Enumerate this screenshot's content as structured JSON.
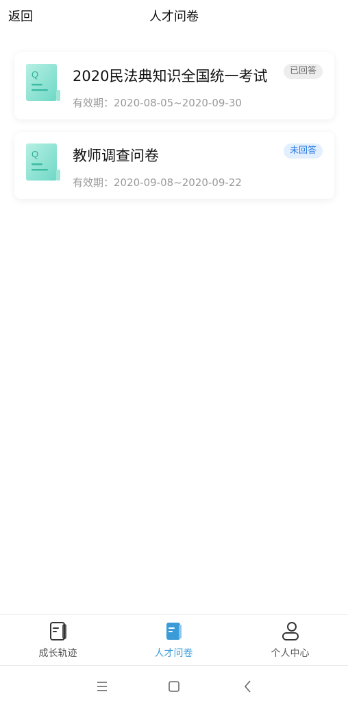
{
  "header": {
    "back_label": "返回",
    "title": "人才问卷"
  },
  "surveys": [
    {
      "title": "2020民法典知识全国统一考试",
      "validity": "有效期：2020-08-05~2020-09-30",
      "status": "已回答",
      "icon": "questionnaire-doc-icon"
    },
    {
      "title": "教师调查问卷",
      "validity": "有效期：2020-09-08~2020-09-22",
      "status": "未回答",
      "icon": "questionnaire-doc-icon"
    }
  ],
  "tabbar": {
    "items": [
      {
        "label": "成长轨迹",
        "icon": "notebook-icon",
        "active": false
      },
      {
        "label": "人才问卷",
        "icon": "notebook-icon",
        "active": true
      },
      {
        "label": "个人中心",
        "icon": "person-icon",
        "active": false
      }
    ]
  },
  "system_nav": {
    "buttons": [
      "menu-icon",
      "home-icon",
      "back-icon"
    ]
  },
  "colors": {
    "accent": "#3a9bd8",
    "icon_teal": "#7fe0cd",
    "badge_done_bg": "#ededed",
    "badge_todo_bg": "#e2efff",
    "badge_todo_text": "#2f7de1"
  }
}
